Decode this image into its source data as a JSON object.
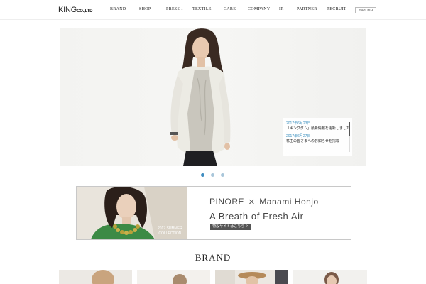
{
  "header": {
    "logo": {
      "main": "KING",
      "suffix": "CO.,LTD"
    },
    "nav": [
      {
        "id": "brand",
        "label": "BRAND",
        "has_dropdown": false
      },
      {
        "id": "shop",
        "label": "SHOP",
        "has_dropdown": false
      },
      {
        "id": "press",
        "label": "PRESS",
        "has_dropdown": true
      },
      {
        "id": "textile",
        "label": "TEXTILE",
        "has_dropdown": false
      },
      {
        "id": "care",
        "label": "CARE",
        "has_dropdown": false
      },
      {
        "id": "company",
        "label": "COMPANY",
        "has_dropdown": false
      },
      {
        "id": "ir",
        "label": "IR",
        "has_dropdown": false
      },
      {
        "id": "partner",
        "label": "PARTNER",
        "has_dropdown": false
      },
      {
        "id": "recruit",
        "label": "RECRUIT",
        "has_dropdown": false
      }
    ],
    "language_button": "ENGLISH"
  },
  "hero": {
    "news": [
      {
        "date": "2017年6月23日",
        "title": "「キングダム」最新情報を更新しました。新着のお知らせ"
      },
      {
        "date": "2017年6月27日",
        "title": "株主の皆さまへのお知らせを掲載"
      }
    ],
    "slides": 3,
    "active_slide": 0
  },
  "banner": {
    "season": "2017 SUMMER",
    "collection": "COLLECTION",
    "brand": "PINORE",
    "times": "×",
    "collaborator": "Manami Honjo",
    "tagline": "A Breath of Fresh Air",
    "link_label": "特設サイトはこちら ＞"
  },
  "brand_section": {
    "heading": "BRAND"
  },
  "colors": {
    "accent": "#3f8dc1",
    "text": "#333333",
    "link_button_bg": "#555555"
  }
}
